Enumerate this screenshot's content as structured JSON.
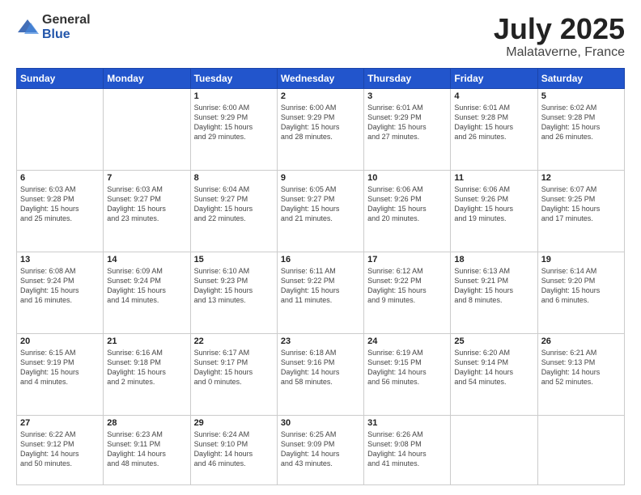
{
  "logo": {
    "general": "General",
    "blue": "Blue"
  },
  "title": {
    "month_year": "July 2025",
    "location": "Malataverne, France"
  },
  "weekdays": [
    "Sunday",
    "Monday",
    "Tuesday",
    "Wednesday",
    "Thursday",
    "Friday",
    "Saturday"
  ],
  "weeks": [
    [
      {
        "day": "",
        "info": ""
      },
      {
        "day": "",
        "info": ""
      },
      {
        "day": "1",
        "info": "Sunrise: 6:00 AM\nSunset: 9:29 PM\nDaylight: 15 hours\nand 29 minutes."
      },
      {
        "day": "2",
        "info": "Sunrise: 6:00 AM\nSunset: 9:29 PM\nDaylight: 15 hours\nand 28 minutes."
      },
      {
        "day": "3",
        "info": "Sunrise: 6:01 AM\nSunset: 9:29 PM\nDaylight: 15 hours\nand 27 minutes."
      },
      {
        "day": "4",
        "info": "Sunrise: 6:01 AM\nSunset: 9:28 PM\nDaylight: 15 hours\nand 26 minutes."
      },
      {
        "day": "5",
        "info": "Sunrise: 6:02 AM\nSunset: 9:28 PM\nDaylight: 15 hours\nand 26 minutes."
      }
    ],
    [
      {
        "day": "6",
        "info": "Sunrise: 6:03 AM\nSunset: 9:28 PM\nDaylight: 15 hours\nand 25 minutes."
      },
      {
        "day": "7",
        "info": "Sunrise: 6:03 AM\nSunset: 9:27 PM\nDaylight: 15 hours\nand 23 minutes."
      },
      {
        "day": "8",
        "info": "Sunrise: 6:04 AM\nSunset: 9:27 PM\nDaylight: 15 hours\nand 22 minutes."
      },
      {
        "day": "9",
        "info": "Sunrise: 6:05 AM\nSunset: 9:27 PM\nDaylight: 15 hours\nand 21 minutes."
      },
      {
        "day": "10",
        "info": "Sunrise: 6:06 AM\nSunset: 9:26 PM\nDaylight: 15 hours\nand 20 minutes."
      },
      {
        "day": "11",
        "info": "Sunrise: 6:06 AM\nSunset: 9:26 PM\nDaylight: 15 hours\nand 19 minutes."
      },
      {
        "day": "12",
        "info": "Sunrise: 6:07 AM\nSunset: 9:25 PM\nDaylight: 15 hours\nand 17 minutes."
      }
    ],
    [
      {
        "day": "13",
        "info": "Sunrise: 6:08 AM\nSunset: 9:24 PM\nDaylight: 15 hours\nand 16 minutes."
      },
      {
        "day": "14",
        "info": "Sunrise: 6:09 AM\nSunset: 9:24 PM\nDaylight: 15 hours\nand 14 minutes."
      },
      {
        "day": "15",
        "info": "Sunrise: 6:10 AM\nSunset: 9:23 PM\nDaylight: 15 hours\nand 13 minutes."
      },
      {
        "day": "16",
        "info": "Sunrise: 6:11 AM\nSunset: 9:22 PM\nDaylight: 15 hours\nand 11 minutes."
      },
      {
        "day": "17",
        "info": "Sunrise: 6:12 AM\nSunset: 9:22 PM\nDaylight: 15 hours\nand 9 minutes."
      },
      {
        "day": "18",
        "info": "Sunrise: 6:13 AM\nSunset: 9:21 PM\nDaylight: 15 hours\nand 8 minutes."
      },
      {
        "day": "19",
        "info": "Sunrise: 6:14 AM\nSunset: 9:20 PM\nDaylight: 15 hours\nand 6 minutes."
      }
    ],
    [
      {
        "day": "20",
        "info": "Sunrise: 6:15 AM\nSunset: 9:19 PM\nDaylight: 15 hours\nand 4 minutes."
      },
      {
        "day": "21",
        "info": "Sunrise: 6:16 AM\nSunset: 9:18 PM\nDaylight: 15 hours\nand 2 minutes."
      },
      {
        "day": "22",
        "info": "Sunrise: 6:17 AM\nSunset: 9:17 PM\nDaylight: 15 hours\nand 0 minutes."
      },
      {
        "day": "23",
        "info": "Sunrise: 6:18 AM\nSunset: 9:16 PM\nDaylight: 14 hours\nand 58 minutes."
      },
      {
        "day": "24",
        "info": "Sunrise: 6:19 AM\nSunset: 9:15 PM\nDaylight: 14 hours\nand 56 minutes."
      },
      {
        "day": "25",
        "info": "Sunrise: 6:20 AM\nSunset: 9:14 PM\nDaylight: 14 hours\nand 54 minutes."
      },
      {
        "day": "26",
        "info": "Sunrise: 6:21 AM\nSunset: 9:13 PM\nDaylight: 14 hours\nand 52 minutes."
      }
    ],
    [
      {
        "day": "27",
        "info": "Sunrise: 6:22 AM\nSunset: 9:12 PM\nDaylight: 14 hours\nand 50 minutes."
      },
      {
        "day": "28",
        "info": "Sunrise: 6:23 AM\nSunset: 9:11 PM\nDaylight: 14 hours\nand 48 minutes."
      },
      {
        "day": "29",
        "info": "Sunrise: 6:24 AM\nSunset: 9:10 PM\nDaylight: 14 hours\nand 46 minutes."
      },
      {
        "day": "30",
        "info": "Sunrise: 6:25 AM\nSunset: 9:09 PM\nDaylight: 14 hours\nand 43 minutes."
      },
      {
        "day": "31",
        "info": "Sunrise: 6:26 AM\nSunset: 9:08 PM\nDaylight: 14 hours\nand 41 minutes."
      },
      {
        "day": "",
        "info": ""
      },
      {
        "day": "",
        "info": ""
      }
    ]
  ]
}
